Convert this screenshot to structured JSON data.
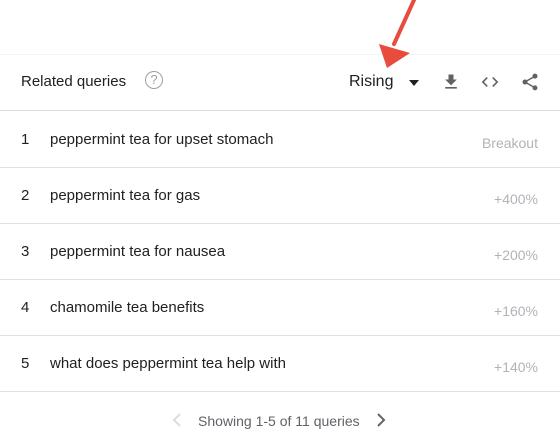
{
  "header": {
    "title": "Related queries",
    "help_icon": "help-circle-icon",
    "dropdown_value": "Rising",
    "icons": [
      "download-icon",
      "embed-code-icon",
      "share-icon"
    ]
  },
  "queries": [
    {
      "rank": "1",
      "query": "peppermint tea for upset stomach",
      "value": "Breakout"
    },
    {
      "rank": "2",
      "query": "peppermint tea for gas",
      "value": "+400%"
    },
    {
      "rank": "3",
      "query": "peppermint tea for nausea",
      "value": "+200%"
    },
    {
      "rank": "4",
      "query": "chamomile tea benefits",
      "value": "+160%"
    },
    {
      "rank": "5",
      "query": "what does peppermint tea help with",
      "value": "+140%"
    }
  ],
  "pagination": {
    "text": "Showing 1-5 of 11 queries"
  },
  "colors": {
    "annotation_arrow": "#e74c3c",
    "divider": "#e0e0e0",
    "muted_value": "#b0b3b8"
  }
}
